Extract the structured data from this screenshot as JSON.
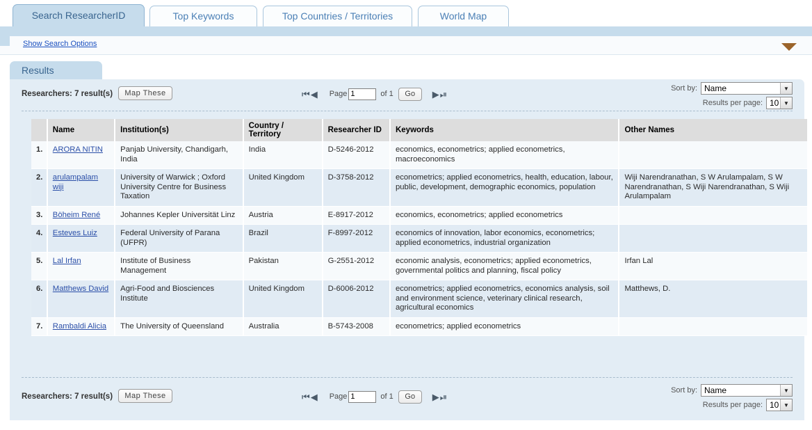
{
  "tabs": [
    {
      "label": "Search ResearcherID",
      "active": true
    },
    {
      "label": "Top Keywords",
      "active": false
    },
    {
      "label": "Top Countries / Territories",
      "active": false
    },
    {
      "label": "World Map",
      "active": false
    }
  ],
  "search_options": {
    "toggle_label": "Show Search Options",
    "collapse_icon": "triangle-down-icon",
    "collapse_color": "#9b642b"
  },
  "results_panel": {
    "tab_label": "Results"
  },
  "toolbar": {
    "results_count_label": "Researchers: 7 result(s)",
    "map_these_label": "Map These",
    "pager": {
      "first_icon": "⏮",
      "prev_icon": "◀",
      "next_icon": "▶",
      "last_icon": "⏭",
      "page_label": "Page",
      "page_value": "1",
      "of_label": "of 1",
      "go_label": "Go"
    },
    "sort_by_label": "Sort by:",
    "sort_by_value": "Name",
    "results_per_page_label": "Results per page:",
    "results_per_page_value": "10",
    "dropdown_icon": "chevron-down-icon"
  },
  "table": {
    "headers": {
      "num": "",
      "name": "Name",
      "institution": "Institution(s)",
      "country": "Country / Territory",
      "researcher_id": "Researcher ID",
      "keywords": "Keywords",
      "other_names": "Other Names"
    },
    "rows": [
      {
        "num": "1.",
        "name": "ARORA NITIN ",
        "institution": "Panjab University, Chandigarh, India",
        "country": "India",
        "researcher_id": "D-5246-2012",
        "keywords": "economics, econometrics; applied econometrics, macroeconomics",
        "other_names": ""
      },
      {
        "num": "2.",
        "name": "arulampalam wiji ",
        "institution": "University of Warwick ; Oxford University Centre for Business Taxation",
        "country": "United Kingdom",
        "researcher_id": "D-3758-2012",
        "keywords": "econometrics; applied econometrics, health, education, labour, public, development, demographic economics, population",
        "other_names": "Wiji Narendranathan, S W Arulampalam, S W Narendranathan, S Wiji Narendranathan, S Wiji Arulampalam"
      },
      {
        "num": "3.",
        "name": "Böheim René ",
        "institution": "Johannes Kepler Universität Linz",
        "country": "Austria",
        "researcher_id": "E-8917-2012",
        "keywords": "economics, econometrics; applied econometrics",
        "other_names": ""
      },
      {
        "num": "4.",
        "name": "Esteves Luiz ",
        "institution": "Federal University of Parana (UFPR)",
        "country": "Brazil",
        "researcher_id": "F-8997-2012",
        "keywords": "economics of innovation, labor economics, econometrics; applied econometrics, industrial organization",
        "other_names": ""
      },
      {
        "num": "5.",
        "name": "Lal Irfan ",
        "institution": "Institute of Business Management",
        "country": "Pakistan",
        "researcher_id": "G-2551-2012",
        "keywords": "economic analysis, econometrics; applied econometrics, governmental politics and planning, fiscal policy",
        "other_names": "Irfan Lal"
      },
      {
        "num": "6.",
        "name": "Matthews David ",
        "institution": "Agri-Food and Biosciences Institute",
        "country": "United Kingdom",
        "researcher_id": "D-6006-2012",
        "keywords": "econometrics; applied econometrics, economics analysis, soil and environment science, veterinary clinical research, agricultural economics",
        "other_names": "Matthews, D."
      },
      {
        "num": "7.",
        "name": "Rambaldi Alicia ",
        "institution": "The University of Queensland",
        "country": "Australia",
        "researcher_id": "B-5743-2008",
        "keywords": "econometrics; applied econometrics",
        "other_names": ""
      }
    ]
  },
  "colors": {
    "tab_active_bg": "#c6dcec",
    "panel_bg": "#e3edf5",
    "header_row_bg": "#dddddd",
    "row_odd_bg": "#f7fafc",
    "row_even_bg": "#e1ebf4",
    "link": "#2b4fa8"
  }
}
